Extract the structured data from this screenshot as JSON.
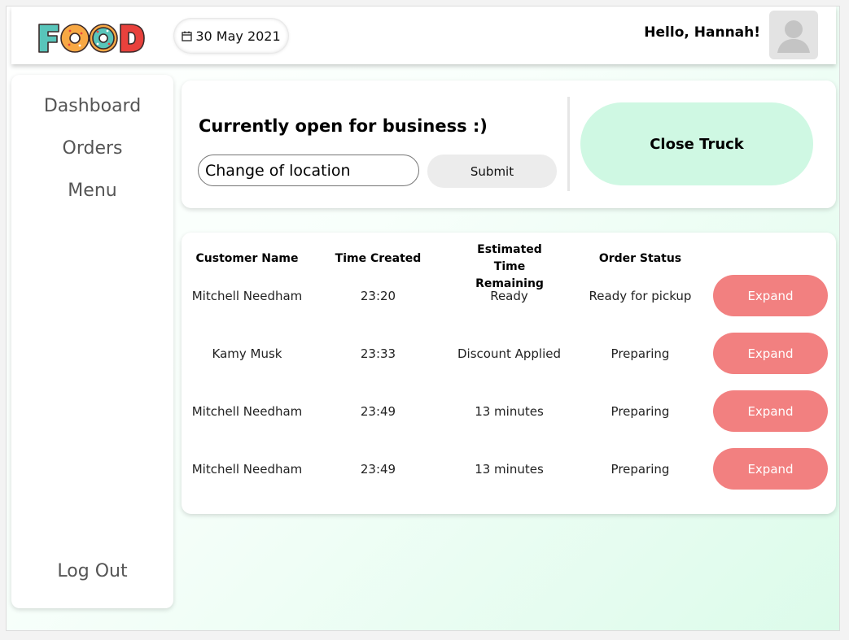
{
  "header": {
    "brand": "FOOD",
    "date": "30 May 2021",
    "greeting": "Hello, Hannah!"
  },
  "sidebar": {
    "items": [
      {
        "label": "Dashboard"
      },
      {
        "label": "Orders"
      },
      {
        "label": "Menu"
      }
    ],
    "logout": "Log Out"
  },
  "status": {
    "title": "Currently open for business :)",
    "location_value": "Change of location",
    "submit_label": "Submit",
    "close_label": "Close Truck"
  },
  "orders": {
    "headers": [
      "Customer Name",
      "Time Created",
      "Estimated Time Remaining",
      "Order Status"
    ],
    "action_label": "Expand",
    "rows": [
      {
        "customer": "Mitchell Needham",
        "time": "23:20",
        "remaining": "Ready",
        "status": "Ready for pickup"
      },
      {
        "customer": "Kamy Musk",
        "time": "23:33",
        "remaining": "Discount Applied",
        "status": "Preparing"
      },
      {
        "customer": "Mitchell Needham",
        "time": "23:49",
        "remaining": "13 minutes",
        "status": "Preparing"
      },
      {
        "customer": "Mitchell Needham",
        "time": "23:49",
        "remaining": "13 minutes",
        "status": "Preparing"
      }
    ]
  },
  "colors": {
    "accent_mint": "#cff8e3",
    "expand_red": "#f28080",
    "logo_teal": "#58c5ba",
    "logo_orange": "#f7a844",
    "logo_red": "#e8413c"
  },
  "icons": {
    "date": "calendar-icon",
    "avatar": "user-avatar-icon"
  }
}
